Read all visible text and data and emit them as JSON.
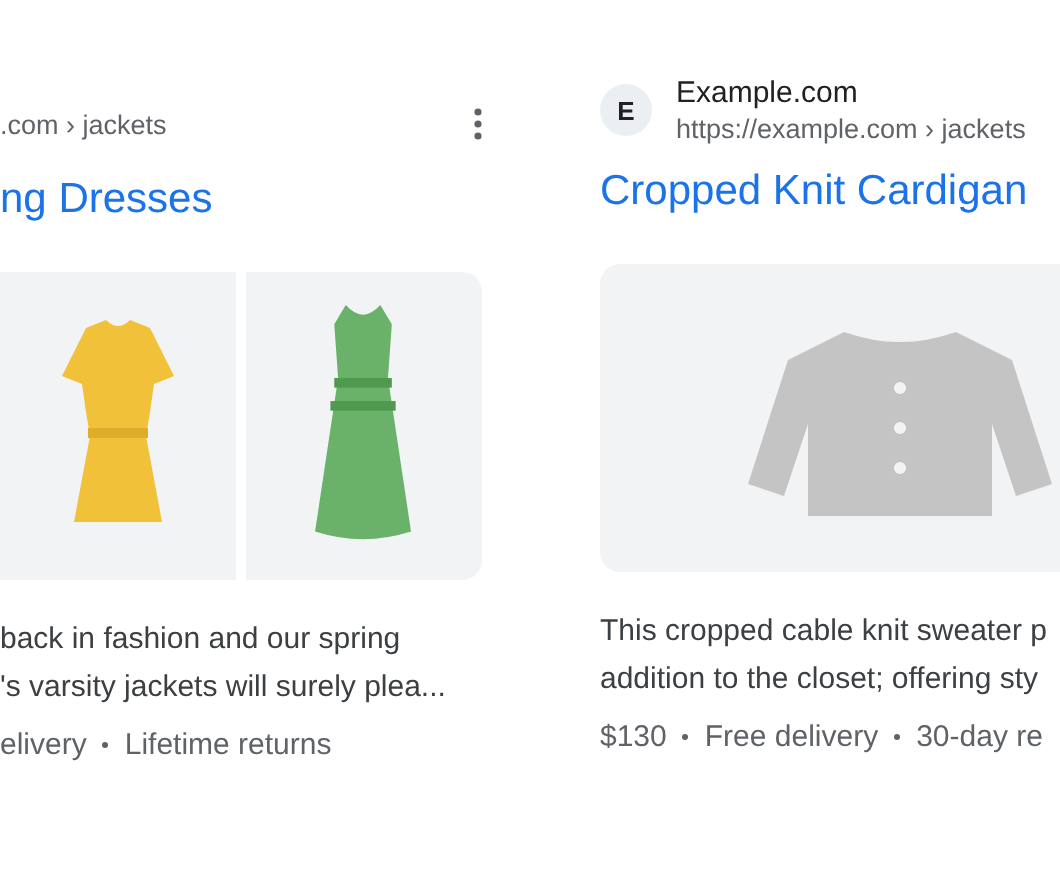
{
  "results": [
    {
      "kind": "cut",
      "url": ".com › jackets",
      "title": "ng Dresses",
      "description": [
        "back in fashion and our spring",
        "'s varsity jackets will surely plea..."
      ],
      "meta": [
        "elivery",
        "Lifetime returns"
      ],
      "menu": true
    },
    {
      "kind": "full",
      "favicon": "E",
      "site": "Example.com",
      "url": "https://example.com › jackets",
      "title": "Cropped Knit Cardigan",
      "description": [
        "This cropped cable knit sweater p",
        "addition to the closet; offering sty"
      ],
      "meta": [
        "$130",
        "Free delivery",
        "30-day re"
      ]
    }
  ]
}
